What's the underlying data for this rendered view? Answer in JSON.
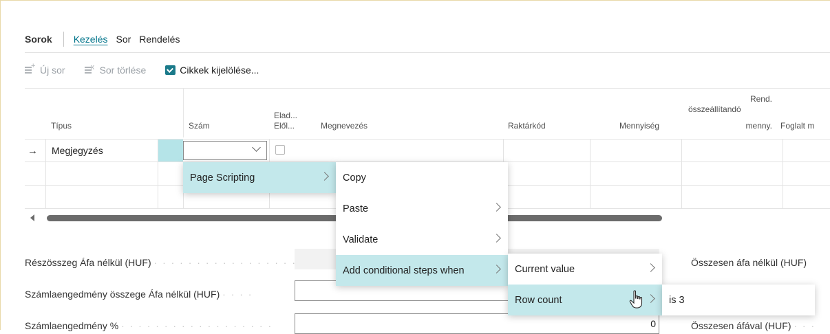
{
  "section": {
    "title": "Sorok",
    "tabs": [
      "Kezelés",
      "Sor",
      "Rendelés"
    ]
  },
  "actions": [
    {
      "label": "Új sor",
      "icon": "new-row-icon"
    },
    {
      "label": "Sor törlése",
      "icon": "delete-row-icon"
    },
    {
      "label": "Cikkek kijelölése...",
      "icon": "select-items-icon"
    }
  ],
  "columns": {
    "tipus": "Típus",
    "szam": "Szám",
    "elad_1": "Elad...",
    "elad_2": "Elől...",
    "megnevezes": "Megnevezés",
    "raktarkod": "Raktárkód",
    "mennyiseg": "Mennyiség",
    "rend_1": "Rend.",
    "rend_2": "összeállítandó",
    "rend_3": "menny.",
    "foglalt": "Foglalt m"
  },
  "rows": [
    {
      "tipus": "Megjegyzés"
    }
  ],
  "fields": {
    "reszosszeg_label": "Részösszeg Áfa nélkül (HUF)",
    "engedmeny_osszeg_label": "Számlaengedmény összege Áfa nélkül (HUF)",
    "engedmeny_pct_label": "Számlaengedmény %",
    "engedmeny_pct_value": "0",
    "osszesen_afa_nelkul_label": "Összesen áfa nélkül (HUF)",
    "osszesen_afaval_label": "Összesen áfával (HUF)",
    "leader": "· · · · · · · · · · · · · · · · · ·"
  },
  "context_menu": {
    "level1": [
      "Page Scripting"
    ],
    "level2": [
      "Copy",
      "Paste",
      "Validate",
      "Add conditional steps when"
    ],
    "level3": [
      "Current value",
      "Row count"
    ],
    "level4": [
      "is 3"
    ]
  },
  "colors": {
    "accent": "#00748b",
    "selected_menu": "#c3e8eb",
    "cell_highlight": "#b5e4e8"
  }
}
